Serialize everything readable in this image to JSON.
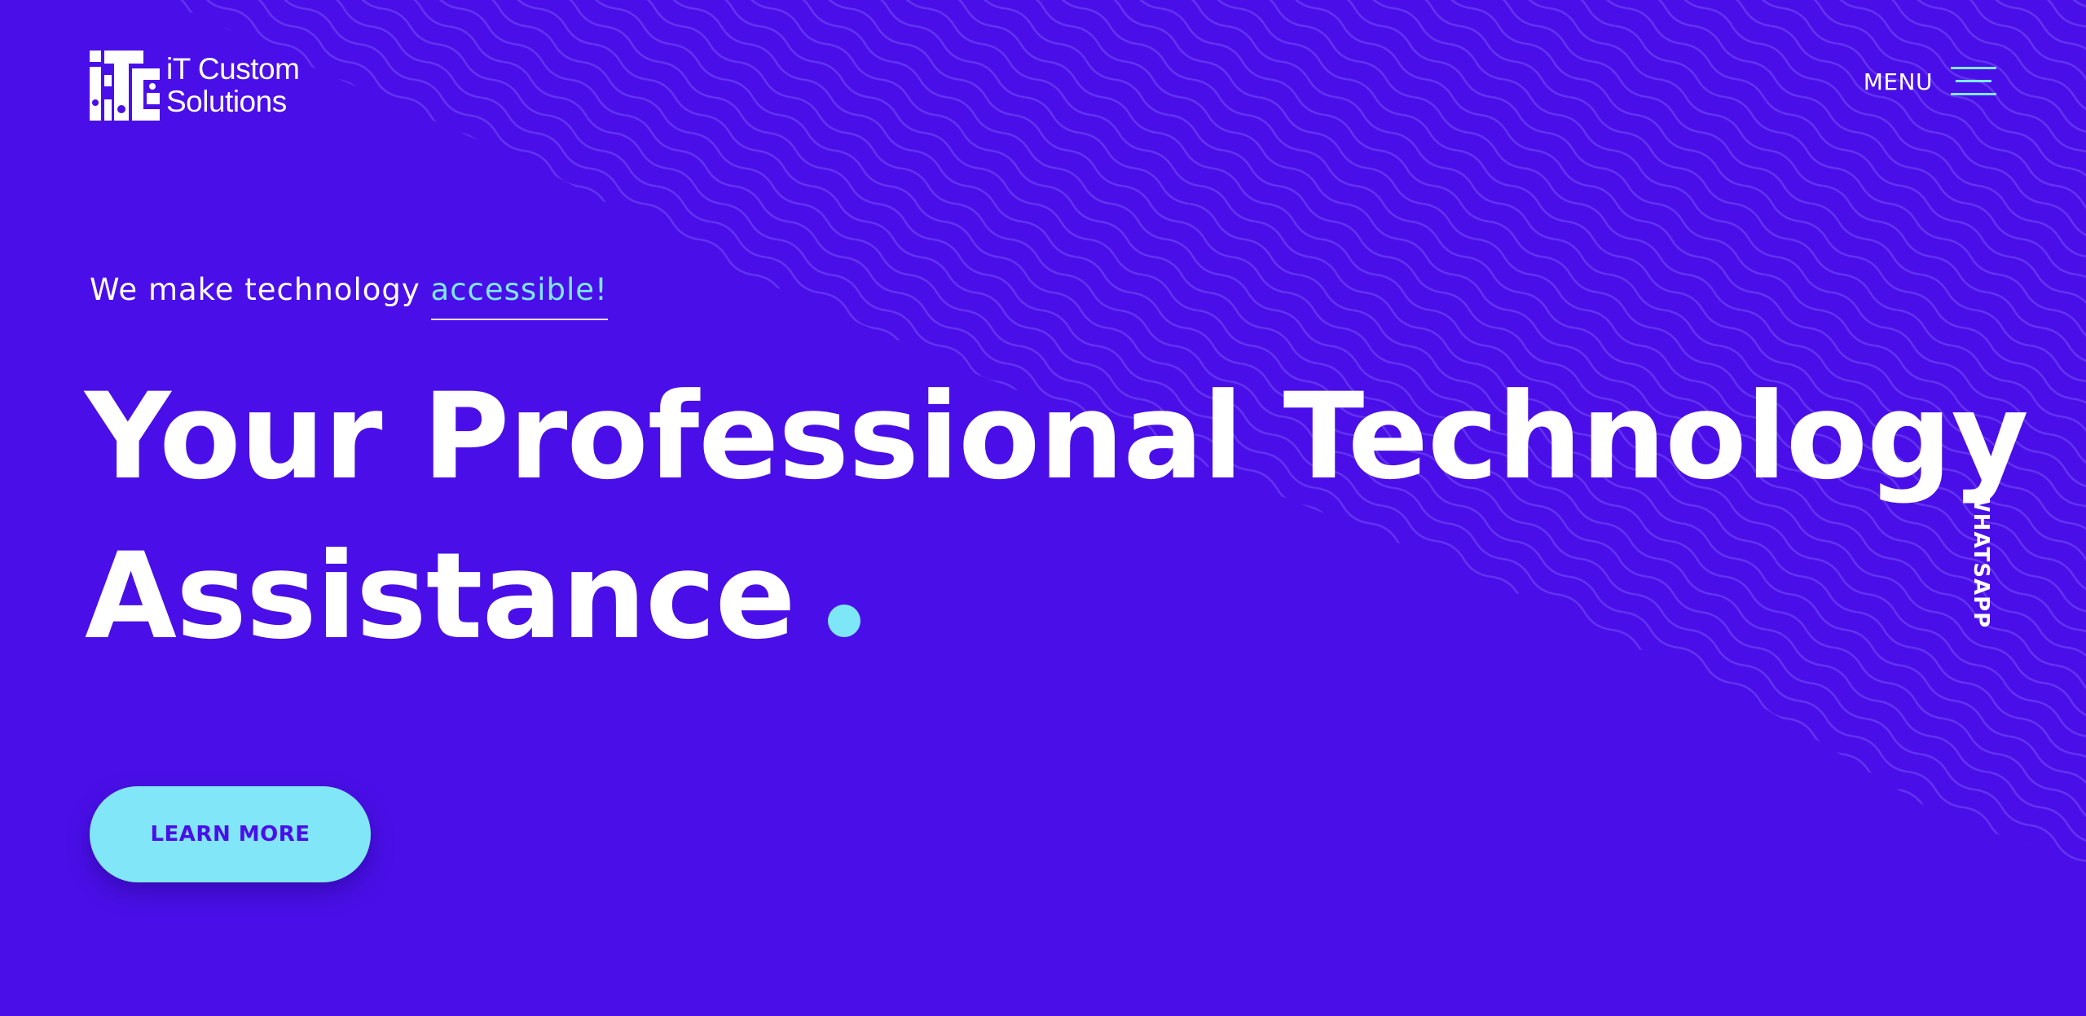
{
  "brand": {
    "name_line1": "iT Custom",
    "name_line2": "Solutions",
    "logo_icon": "itcs-logo-icon"
  },
  "nav": {
    "menu_label": "MENU",
    "menu_icon": "hamburger-icon"
  },
  "hero": {
    "tagline_prefix": "We make technology ",
    "tagline_accent": "accessible!",
    "headline_line1": "Your Professional Technology",
    "headline_line2": "Assistance",
    "cta_label": "LEARN MORE"
  },
  "side": {
    "whatsapp_label": "WHATSAPP"
  },
  "colors": {
    "background": "#4a0fe8",
    "accent": "#7ee7f7",
    "text": "#ffffff"
  }
}
